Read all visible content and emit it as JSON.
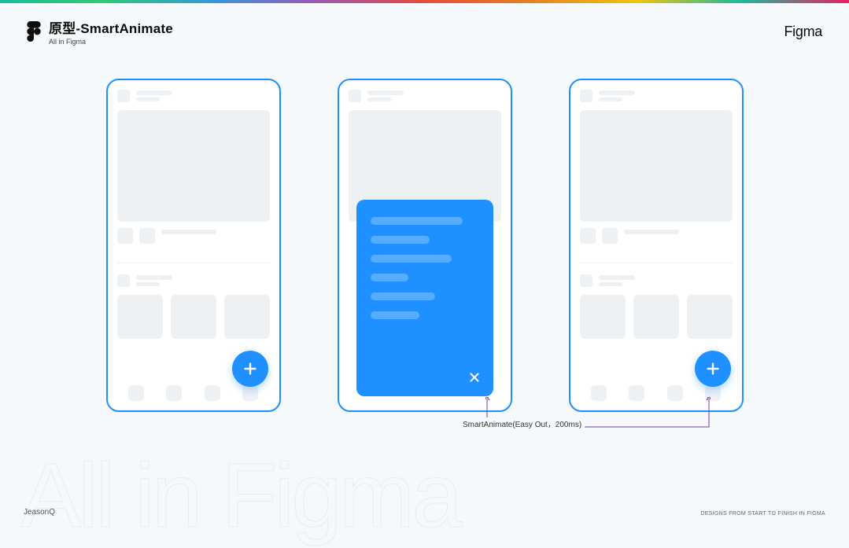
{
  "header": {
    "title": "原型-SmartAnimate",
    "subtitle": "All in Figma",
    "brand": "Figma"
  },
  "connector": {
    "label": "SmartAnimate(Easy Out，200ms)"
  },
  "watermark": "All in Figma",
  "footer": {
    "left": "JeasonQ",
    "right": "DESIGNS FROM START TO FINISH IN FIGMA"
  }
}
